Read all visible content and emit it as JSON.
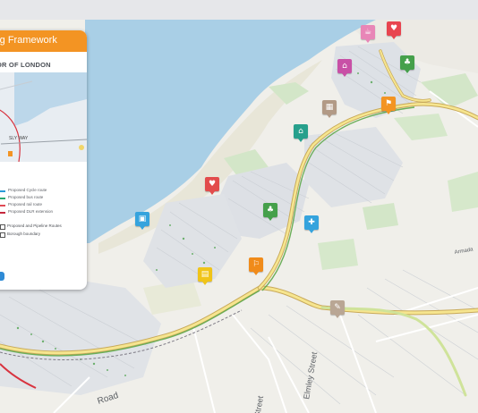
{
  "panel": {
    "title": "rg Framework",
    "subtitle": "OR OF LONDON",
    "inset_label": "SLY WAY",
    "legend": [
      {
        "label": "Proposed Cycle route",
        "color": "#2a9bd8"
      },
      {
        "label": "Proposed bus route",
        "color": "#2aa871"
      },
      {
        "label": "Proposed rail route",
        "color": "#e04a55"
      },
      {
        "label": "Proposed DLR extension",
        "color": "#c5283d"
      }
    ],
    "toggles": [
      {
        "label": "Proposed and Pipeline Routes"
      },
      {
        "label": "Borough boundary"
      }
    ],
    "accent_color": "#f39423"
  },
  "roads": {
    "road_1": "Road",
    "road_2": "Street",
    "road_3": "Elmley Street",
    "road_4": "Armada"
  },
  "markers": [
    {
      "name": "marker-food",
      "color": "#e886b7",
      "icon": "food-icon",
      "glyph": "☕"
    },
    {
      "name": "marker-heart",
      "color": "#e8454f",
      "icon": "heart-icon",
      "glyph": "♥"
    },
    {
      "name": "marker-home",
      "color": "#c850a6",
      "icon": "home-icon",
      "glyph": "⌂"
    },
    {
      "name": "marker-tree",
      "color": "#45a04b",
      "icon": "tree-icon",
      "glyph": "♣"
    },
    {
      "name": "marker-building",
      "color": "#b29a86",
      "icon": "building-icon",
      "glyph": "▦"
    },
    {
      "name": "marker-transport",
      "color": "#f39423",
      "icon": "transport-icon",
      "glyph": "⚑"
    },
    {
      "name": "marker-community",
      "color": "#27a08c",
      "icon": "community-icon",
      "glyph": "⌂"
    },
    {
      "name": "marker-health",
      "color": "#e24c4c",
      "icon": "health-icon",
      "glyph": "♥"
    },
    {
      "name": "marker-education",
      "color": "#35a3dd",
      "icon": "education-icon",
      "glyph": "▣"
    },
    {
      "name": "marker-park",
      "color": "#45a04b",
      "icon": "park-icon",
      "glyph": "♣"
    },
    {
      "name": "marker-water",
      "color": "#35a3dd",
      "icon": "water-icon",
      "glyph": "✚"
    },
    {
      "name": "marker-retail",
      "color": "#f0c419",
      "icon": "retail-icon",
      "glyph": "▤"
    },
    {
      "name": "marker-station",
      "color": "#f08b1a",
      "icon": "station-icon",
      "glyph": "⚐"
    },
    {
      "name": "marker-infra",
      "color": "#b9a694",
      "icon": "infrastructure-icon",
      "glyph": "✎"
    }
  ]
}
